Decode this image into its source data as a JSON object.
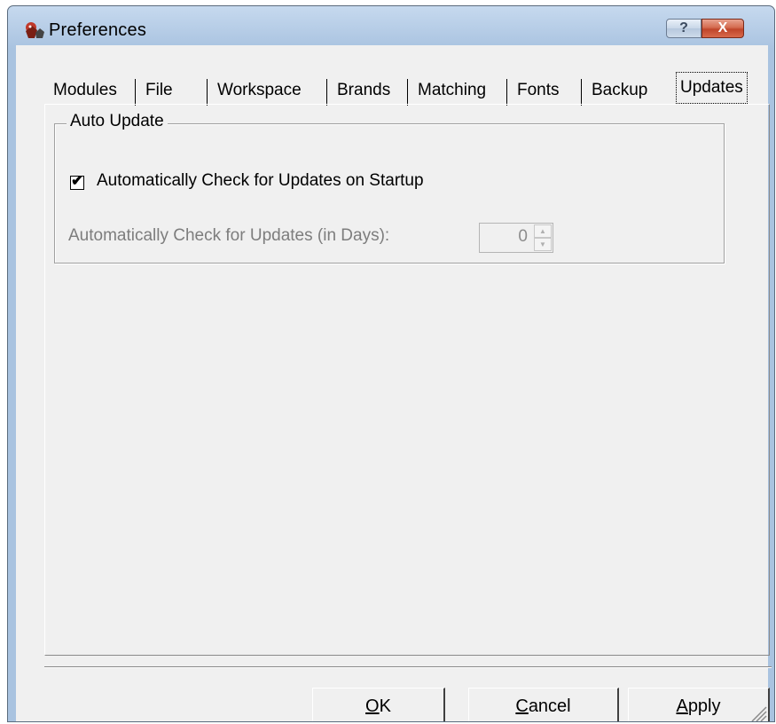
{
  "window": {
    "title": "Preferences",
    "help_glyph": "?",
    "close_glyph": "X",
    "icon": "app-wolf-icon"
  },
  "tabs": [
    {
      "label": "Modules"
    },
    {
      "label": "File"
    },
    {
      "label": "Workspace"
    },
    {
      "label": "Brands"
    },
    {
      "label": "Matching"
    },
    {
      "label": "Fonts"
    },
    {
      "label": "Backup"
    },
    {
      "label": "Updates",
      "active": true
    }
  ],
  "auto_update": {
    "group_title": "Auto Update",
    "checkbox_label": "Automatically Check for Updates on Startup",
    "checkbox_checked": true,
    "days_label": "Automatically Check for Updates (in Days):",
    "days_value": "0",
    "days_enabled": false
  },
  "buttons": {
    "ok_prefix": "",
    "ok_mnemonic": "O",
    "ok_rest": "K",
    "cancel_mnemonic": "C",
    "cancel_rest": "ancel",
    "apply_mnemonic": "A",
    "apply_rest": "pply"
  },
  "colors": {
    "titlebar": "#b9cfe8",
    "dialog_bg": "#f0f0f0",
    "close_button": "#c9482c",
    "disabled_text": "#7d7d7d"
  }
}
